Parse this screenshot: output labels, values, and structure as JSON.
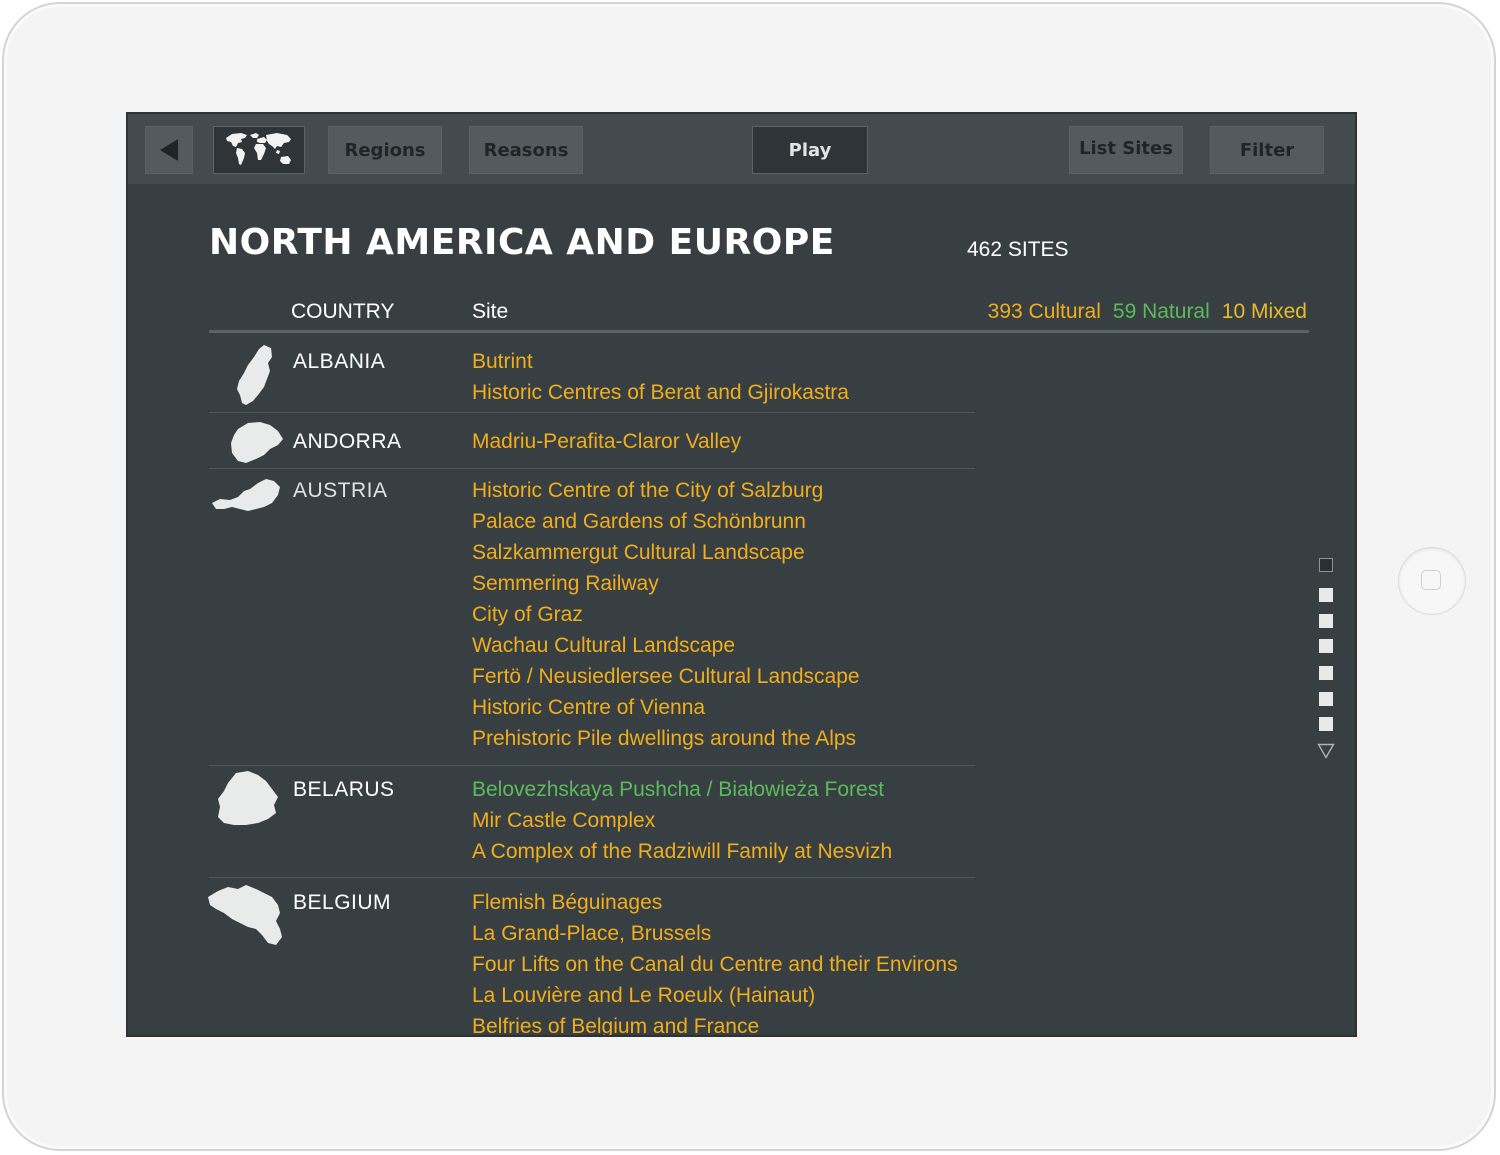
{
  "toolbar": {
    "back_icon": "back-arrow-icon",
    "map_icon": "world-map-icon",
    "regions_label": "Regions",
    "reasons_label": "Reasons",
    "play_label": "Play",
    "list_sites_label": "List Sites",
    "filter_label": "Filter"
  },
  "page": {
    "title": "NORTH AMERICA AND EUROPE",
    "site_count": "462 SITES"
  },
  "table": {
    "country_header": "COUNTRY",
    "site_header": "Site",
    "summary": {
      "cultural": "393 Cultural",
      "natural": "59 Natural",
      "mixed": "10 Mixed"
    }
  },
  "countries": [
    {
      "name": "ALBANIA",
      "sites": [
        {
          "name": "Butrint",
          "type": "cultural"
        },
        {
          "name": "Historic Centres of Berat and Gjirokastra",
          "type": "cultural"
        }
      ]
    },
    {
      "name": "ANDORRA",
      "sites": [
        {
          "name": "Madriu-Perafita-Claror Valley",
          "type": "cultural"
        }
      ]
    },
    {
      "name": "AUSTRIA",
      "sites": [
        {
          "name": "Historic Centre of the City of Salzburg",
          "type": "cultural"
        },
        {
          "name": "Palace and Gardens of Schönbrunn",
          "type": "cultural"
        },
        {
          "name": "Salzkammergut Cultural  Landscape",
          "type": "cultural"
        },
        {
          "name": "Semmering Railway",
          "type": "cultural"
        },
        {
          "name": "City of Graz",
          "type": "cultural"
        },
        {
          "name": "Wachau Cultural Landscape",
          "type": "cultural"
        },
        {
          "name": "Fertö / Neusiedlersee Cultural Landscape",
          "type": "cultural"
        },
        {
          "name": "Historic Centre of Vienna",
          "type": "cultural"
        },
        {
          "name": "Prehistoric Pile dwellings around the Alps",
          "type": "cultural"
        }
      ]
    },
    {
      "name": "BELARUS",
      "sites": [
        {
          "name": "Belovezhskaya Pushcha / Białowieża Forest",
          "type": "natural"
        },
        {
          "name": "Mir Castle Complex",
          "type": "cultural"
        },
        {
          "name": "A Complex of the Radziwill Family at Nesvizh",
          "type": "cultural"
        }
      ]
    },
    {
      "name": "BELGIUM",
      "sites": [
        {
          "name": "Flemish Béguinages",
          "type": "cultural"
        },
        {
          "name": "La Grand-Place, Brussels",
          "type": "cultural"
        },
        {
          "name": "Four Lifts on the Canal du Centre and their Environs",
          "type": "cultural"
        },
        {
          "name": "La Louvière and Le Roeulx (Hainaut)",
          "type": "cultural"
        },
        {
          "name": "Belfries of Belgium and France",
          "type": "cultural"
        }
      ]
    }
  ],
  "pagination": {
    "pages": 7,
    "current": 1
  },
  "colors": {
    "screen_bg": "#383f43",
    "toolbar_bg": "#444b4f",
    "cultural": "#f0ad1c",
    "natural": "#5cba5c",
    "mixed": "#e9ba2a",
    "text": "#ffffff"
  }
}
